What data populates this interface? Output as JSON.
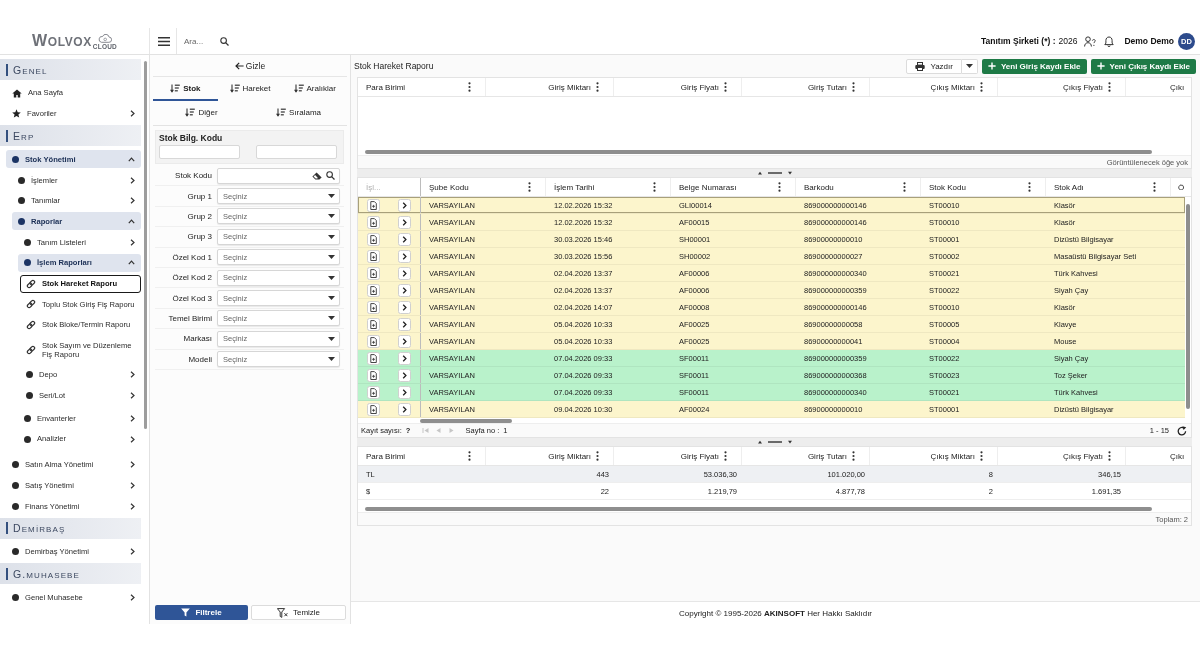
{
  "header": {
    "logo": {
      "name": "WOLVOX",
      "suffix": "CLOUD"
    },
    "search": {
      "placeholder": "Ara..."
    },
    "company": "Tanıtım Şirketi (*) :",
    "year": "2026",
    "user": {
      "name": "Demo Demo",
      "initials": "DD"
    }
  },
  "sidebar": {
    "sections": [
      {
        "title": "GENEL",
        "items": [
          {
            "label": "Ana Sayfa",
            "kind": "home",
            "selected": false
          },
          {
            "label": "Favoriler",
            "kind": "favorites",
            "selected": false,
            "expanded": false
          }
        ]
      },
      {
        "title": "ERP",
        "items": [
          {
            "label": "Stok Yönetimi",
            "kind": "module",
            "selected": false,
            "expanded": true,
            "children": [
              {
                "label": "İşlemler",
                "kind": "module",
                "selected": false,
                "expanded": false
              },
              {
                "label": "Tanımlar",
                "kind": "module",
                "selected": false,
                "expanded": false
              },
              {
                "label": "Raporlar",
                "kind": "module",
                "selected": false,
                "expanded": true,
                "children": [
                  {
                    "label": "Tanım Listeleri",
                    "kind": "module",
                    "selected": false,
                    "expanded": false
                  },
                  {
                    "label": "İşlem Raporları",
                    "kind": "module",
                    "selected": false,
                    "expanded": true,
                    "children": [
                      {
                        "label": "Stok Hareket Raporu",
                        "kind": "report",
                        "selected": true
                      },
                      {
                        "label": "Toplu Stok Giriş Fiş Raporu",
                        "kind": "report",
                        "selected": false
                      },
                      {
                        "label": "Stok Bloke/Termin Raporu",
                        "kind": "report",
                        "selected": false
                      },
                      {
                        "label": "Stok Sayım ve Düzenleme Fiş Raporu",
                        "kind": "report",
                        "selected": false
                      },
                      {
                        "label": "Depo",
                        "kind": "module",
                        "selected": false,
                        "expanded": false
                      },
                      {
                        "label": "Seri/Lot",
                        "kind": "module",
                        "selected": false,
                        "expanded": false
                      }
                    ]
                  },
                  {
                    "label": "Envanterler",
                    "kind": "module",
                    "selected": false,
                    "expanded": false
                  },
                  {
                    "label": "Analizler",
                    "kind": "module",
                    "selected": false,
                    "expanded": false
                  }
                ]
              }
            ]
          },
          {
            "label": "Satın Alma Yönetimi",
            "kind": "module",
            "selected": false,
            "expanded": false
          },
          {
            "label": "Satış Yönetimi",
            "kind": "module",
            "selected": false,
            "expanded": false
          },
          {
            "label": "Finans Yönetimi",
            "kind": "module",
            "selected": false,
            "expanded": false
          }
        ]
      },
      {
        "title": "DEMİRBAŞ",
        "items": [
          {
            "label": "Demirbaş Yönetimi",
            "kind": "module",
            "selected": false,
            "expanded": false
          }
        ]
      },
      {
        "title": "G.MUHASEBE",
        "items": [
          {
            "label": "Genel Muhasebe",
            "kind": "module",
            "selected": false,
            "expanded": false
          }
        ]
      }
    ]
  },
  "filter_panel": {
    "hide_button": "Gizle",
    "tabs": [
      {
        "label": "Stok",
        "selected": true
      },
      {
        "label": "Hareket",
        "selected": false
      },
      {
        "label": "Aralıklar",
        "selected": false
      },
      {
        "label": "Diğer",
        "selected": false
      },
      {
        "label": "Sıralama",
        "selected": false
      }
    ],
    "fields": [
      {
        "label": "Stok Bilg. Kodu",
        "kind": "range"
      },
      {
        "label": "Stok Kodu",
        "kind": "search"
      },
      {
        "label": "Grup 1",
        "kind": "select",
        "placeholder": "Seçiniz"
      },
      {
        "label": "Grup 2",
        "kind": "select",
        "placeholder": "Seçiniz"
      },
      {
        "label": "Grup 3",
        "kind": "select",
        "placeholder": "Seçiniz"
      },
      {
        "label": "Özel Kod 1",
        "kind": "select",
        "placeholder": "Seçiniz"
      },
      {
        "label": "Özel Kod 2",
        "kind": "select",
        "placeholder": "Seçiniz"
      },
      {
        "label": "Özel Kod 3",
        "kind": "select",
        "placeholder": "Seçiniz"
      },
      {
        "label": "Temel Birimi",
        "kind": "select",
        "placeholder": "Seçiniz"
      },
      {
        "label": "Markası",
        "kind": "select",
        "placeholder": "Seçiniz"
      },
      {
        "label": "Modeli",
        "kind": "select",
        "placeholder": "Seçiniz"
      }
    ],
    "buttons": [
      {
        "label": "Filtrele",
        "kind": "primary"
      },
      {
        "label": "Temizle",
        "kind": "secondary"
      }
    ]
  },
  "report": {
    "title": "Stok Hareket Raporu",
    "actions": [
      {
        "label": "Yazdır",
        "kind": "print"
      },
      {
        "label": "Yeni Giriş Kaydı Ekle",
        "kind": "add"
      },
      {
        "label": "Yeni Çıkış Kaydı Ekle",
        "kind": "add"
      }
    ],
    "summary_top": {
      "columns": [
        {
          "label": "Para Birimi",
          "kind": "text"
        },
        {
          "label": "Giriş Miktarı",
          "kind": "number"
        },
        {
          "label": "Giriş Fiyatı",
          "kind": "number"
        },
        {
          "label": "Giriş Tutarı",
          "kind": "number"
        },
        {
          "label": "Çıkış Miktarı",
          "kind": "number"
        },
        {
          "label": "Çıkış Fiyatı",
          "kind": "number"
        },
        {
          "label": "Çıkı",
          "kind": "number"
        }
      ],
      "empty_text": "Görüntülenecek öğe yok"
    },
    "movements": {
      "lead_column": "İşl...",
      "columns": [
        {
          "label": "Şube Kodu"
        },
        {
          "label": "İşlem Tarihi"
        },
        {
          "label": "Belge Numarası"
        },
        {
          "label": "Barkodu"
        },
        {
          "label": "Stok Kodu"
        },
        {
          "label": "Stok Adı"
        },
        {
          "label": "Ö"
        }
      ],
      "rows": [
        {
          "cells": [
            "VARSAYILAN",
            "12.02.2026 15:32",
            "GLI00014",
            "869000000000146",
            "ST00010",
            "Klasör"
          ],
          "color": "#fcf5cc",
          "selected": true
        },
        {
          "cells": [
            "VARSAYILAN",
            "12.02.2026 15:32",
            "AF00015",
            "869000000000146",
            "ST00010",
            "Klasör"
          ],
          "color": "#fcf5cc",
          "selected": false
        },
        {
          "cells": [
            "VARSAYILAN",
            "30.03.2026 15:46",
            "SH00001",
            "86900000000010",
            "ST00001",
            "Dizüstü Bilgisayar"
          ],
          "color": "#fcf5cc",
          "selected": false
        },
        {
          "cells": [
            "VARSAYILAN",
            "30.03.2026 15:56",
            "SH00002",
            "86900000000027",
            "ST00002",
            "Masaüstü Bilgisayar Seti"
          ],
          "color": "#fcf5cc",
          "selected": false
        },
        {
          "cells": [
            "VARSAYILAN",
            "02.04.2026 13:37",
            "AF00006",
            "869000000000340",
            "ST00021",
            "Türk Kahvesi"
          ],
          "color": "#fcf5cc",
          "selected": false
        },
        {
          "cells": [
            "VARSAYILAN",
            "02.04.2026 13:37",
            "AF00006",
            "869000000000359",
            "ST00022",
            "Siyah Çay"
          ],
          "color": "#fcf5cc",
          "selected": false
        },
        {
          "cells": [
            "VARSAYILAN",
            "02.04.2026 14:07",
            "AF00008",
            "869000000000146",
            "ST00010",
            "Klasör"
          ],
          "color": "#fcf5cc",
          "selected": false
        },
        {
          "cells": [
            "VARSAYILAN",
            "05.04.2026 10:33",
            "AF00025",
            "86900000000058",
            "ST00005",
            "Klavye"
          ],
          "color": "#fcf5cc",
          "selected": false
        },
        {
          "cells": [
            "VARSAYILAN",
            "05.04.2026 10:33",
            "AF00025",
            "86900000000041",
            "ST00004",
            "Mouse"
          ],
          "color": "#fcf5cc",
          "selected": false
        },
        {
          "cells": [
            "VARSAYILAN",
            "07.04.2026 09:33",
            "SF00011",
            "869000000000359",
            "ST00022",
            "Siyah Çay"
          ],
          "color": "#b9f2cb",
          "selected": false
        },
        {
          "cells": [
            "VARSAYILAN",
            "07.04.2026 09:33",
            "SF00011",
            "869000000000368",
            "ST00023",
            "Toz Şeker"
          ],
          "color": "#b9f2cb",
          "selected": false
        },
        {
          "cells": [
            "VARSAYILAN",
            "07.04.2026 09:33",
            "SF00011",
            "869000000000340",
            "ST00021",
            "Türk Kahvesi"
          ],
          "color": "#b9f2cb",
          "selected": false
        },
        {
          "cells": [
            "VARSAYILAN",
            "09.04.2026 10:30",
            "AF00024",
            "86900000000010",
            "ST00001",
            "Dizüstü Bilgisayar"
          ],
          "color": "#fcf5cc",
          "selected": false
        }
      ],
      "pager": {
        "count_label": "Kayıt sayısı:",
        "count": "?",
        "nav": [
          {
            "kind": "first",
            "disabled": true
          },
          {
            "kind": "previous",
            "disabled": true
          },
          {
            "kind": "next",
            "disabled": true
          }
        ],
        "page_label": "Sayfa no :",
        "page": "1",
        "range": "1 - 15"
      }
    },
    "summary_bottom": {
      "columns": [
        {
          "label": "Para Birimi",
          "kind": "text"
        },
        {
          "label": "Giriş Miktarı",
          "kind": "number"
        },
        {
          "label": "Giriş Fiyatı",
          "kind": "number"
        },
        {
          "label": "Giriş Tutarı",
          "kind": "number"
        },
        {
          "label": "Çıkış Miktarı",
          "kind": "number"
        },
        {
          "label": "Çıkış Fiyatı",
          "kind": "number"
        },
        {
          "label": "Çıkı",
          "kind": "number"
        }
      ],
      "rows": [
        {
          "cells": [
            "TL",
            "443",
            "53.036,30",
            "101.020,00",
            "8",
            "346,15"
          ],
          "selected": true
        },
        {
          "cells": [
            "$",
            "22",
            "1.219,79",
            "4.877,78",
            "2",
            "1.691,35"
          ],
          "selected": false
        }
      ],
      "total": "Toplam: 2"
    }
  },
  "footer": {
    "copyright": "Copyright © 1995-2026 **AKINSOFT** Her Hakkı Saklıdır"
  }
}
